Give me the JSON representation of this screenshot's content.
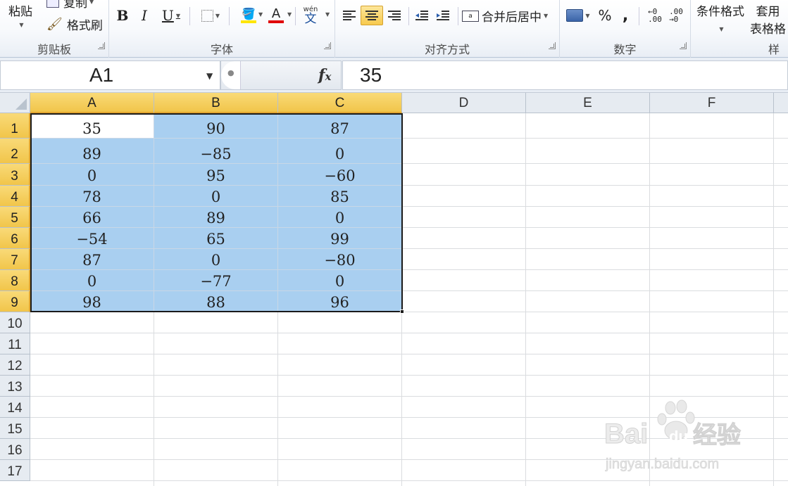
{
  "ribbon": {
    "clipboard": {
      "paste": "粘贴",
      "copy": "复制",
      "format_painter": "格式刷",
      "label": "剪贴板"
    },
    "font": {
      "bold": "B",
      "italic": "I",
      "underline": "U",
      "font_color_glyph": "A",
      "phonetic_top": "wén",
      "phonetic_bottom": "文",
      "label": "字体"
    },
    "alignment": {
      "merge_center": "合并后居中",
      "label": "对齐方式"
    },
    "number": {
      "percent": "%",
      "comma": ",",
      "label": "数字"
    },
    "styles": {
      "conditional_format": "条件格式",
      "table_format_line1": "套用",
      "table_format_line2": "表格格",
      "label": "样"
    }
  },
  "formula_bar": {
    "name_box": "A1",
    "fx": "fx",
    "value": "35"
  },
  "columns": [
    "A",
    "B",
    "C",
    "D",
    "E",
    "F"
  ],
  "rows": [
    "1",
    "2",
    "3",
    "4",
    "5",
    "6",
    "7",
    "8",
    "9",
    "10",
    "11",
    "12",
    "13",
    "14",
    "15",
    "16",
    "17"
  ],
  "cells": [
    [
      "35",
      "90",
      "87"
    ],
    [
      "89",
      "−85",
      "0"
    ],
    [
      "0",
      "95",
      "−60"
    ],
    [
      "78",
      "0",
      "85"
    ],
    [
      "66",
      "89",
      "0"
    ],
    [
      "−54",
      "65",
      "99"
    ],
    [
      "87",
      "0",
      "−80"
    ],
    [
      "0",
      "−77",
      "0"
    ],
    [
      "98",
      "88",
      "96"
    ]
  ],
  "watermark": {
    "brand": "Bai",
    "brand2": "du",
    "suffix": "经验",
    "url": "jingyan.baidu.com"
  },
  "colors": {
    "selection_fill": "#a9cff0",
    "header_selected": "#f4cb55",
    "font_color_bar": "#e00000",
    "fill_color_bar": "#ffe600"
  },
  "icons": [
    "paste-icon",
    "copy-icon",
    "format-painter-icon",
    "border-icon",
    "fill-color-icon",
    "font-color-icon",
    "phonetic-icon",
    "align-left-icon",
    "align-center-icon",
    "align-right-icon",
    "decrease-indent-icon",
    "increase-indent-icon",
    "merge-center-icon",
    "currency-icon",
    "increase-decimal-icon",
    "decrease-decimal-icon",
    "fx-icon"
  ]
}
